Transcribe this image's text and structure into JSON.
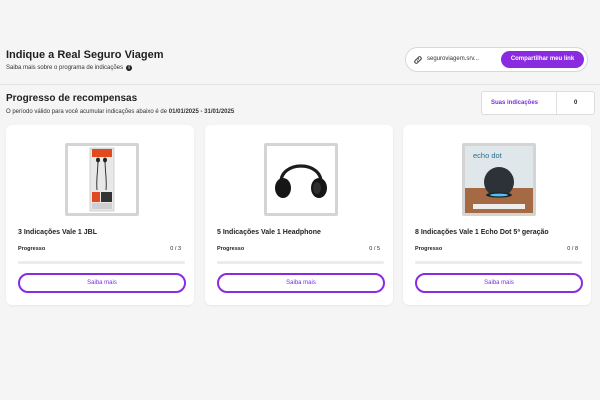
{
  "header": {
    "title": "Indique a Real Seguro Viagem",
    "subtitle": "Saiba mais sobre o programa de indicações",
    "info_icon": "info-icon",
    "share": {
      "url": "seguroviagem.srv...",
      "button_label": "Compartilhar meu link",
      "link_icon": "link-icon"
    }
  },
  "rewards": {
    "title": "Progresso de recompensas",
    "note_prefix": "O período válido para você acumular indicações abaixo é de",
    "period": "01/01/2025 - 31/01/2025",
    "referrals_label": "Suas indicações",
    "referrals_count": "0"
  },
  "colors": {
    "accent": "#8a2be2"
  },
  "cards": [
    {
      "title": "3 Indicações Vale 1 JBL",
      "progress_label": "Progresso",
      "progress_text": "0 / 3",
      "progress_fraction": 0,
      "button_label": "Saiba mais",
      "image": "jbl-earphones-box"
    },
    {
      "title": "5 Indicações Vale 1 Headphone",
      "progress_label": "Progresso",
      "progress_text": "0 / 5",
      "progress_fraction": 0,
      "button_label": "Saiba mais",
      "image": "black-headphone"
    },
    {
      "title": "8 Indicações Vale 1 Echo Dot 5ª geração",
      "progress_label": "Progresso",
      "progress_text": "0 / 8",
      "progress_fraction": 0,
      "button_label": "Saiba mais",
      "image": "echo-dot-box",
      "image_text": "echo dot"
    }
  ]
}
